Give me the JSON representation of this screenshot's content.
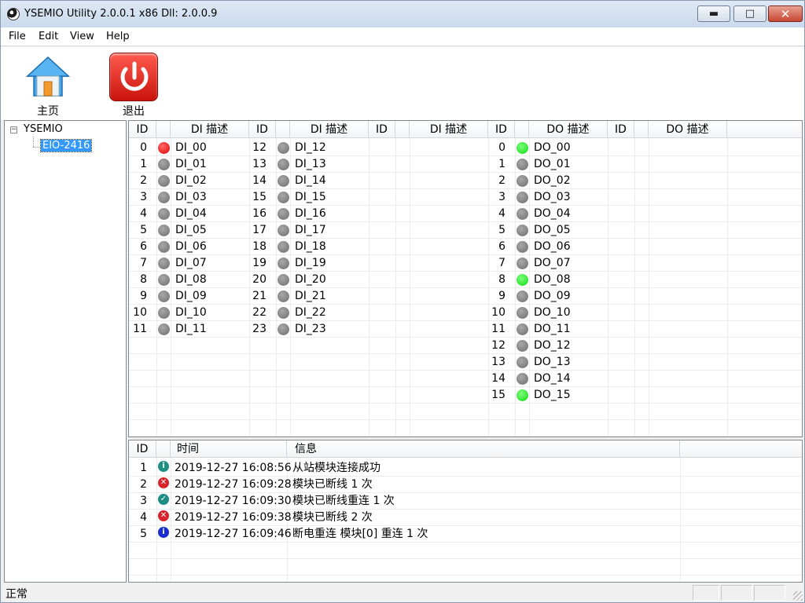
{
  "window": {
    "title": "YSEMIO Utility 2.0.0.1 x86 Dll: 2.0.0.9"
  },
  "menu": [
    "File",
    "Edit",
    "View",
    "Help"
  ],
  "toolbar": {
    "home_label": "主页",
    "exit_label": "退出"
  },
  "tree": {
    "root": "YSEMIO",
    "child": "EIO-2416",
    "expander": "−"
  },
  "io_headers": {
    "id": "ID",
    "di_desc": "DI 描述",
    "do_desc": "DO 描述"
  },
  "di_col1": [
    {
      "id": "0",
      "name": "DI_00",
      "state": "red"
    },
    {
      "id": "1",
      "name": "DI_01",
      "state": "gray"
    },
    {
      "id": "2",
      "name": "DI_02",
      "state": "gray"
    },
    {
      "id": "3",
      "name": "DI_03",
      "state": "gray"
    },
    {
      "id": "4",
      "name": "DI_04",
      "state": "gray"
    },
    {
      "id": "5",
      "name": "DI_05",
      "state": "gray"
    },
    {
      "id": "6",
      "name": "DI_06",
      "state": "gray"
    },
    {
      "id": "7",
      "name": "DI_07",
      "state": "gray"
    },
    {
      "id": "8",
      "name": "DI_08",
      "state": "gray"
    },
    {
      "id": "9",
      "name": "DI_09",
      "state": "gray"
    },
    {
      "id": "10",
      "name": "DI_10",
      "state": "gray"
    },
    {
      "id": "11",
      "name": "DI_11",
      "state": "gray"
    }
  ],
  "di_col2": [
    {
      "id": "12",
      "name": "DI_12",
      "state": "gray"
    },
    {
      "id": "13",
      "name": "DI_13",
      "state": "gray"
    },
    {
      "id": "14",
      "name": "DI_14",
      "state": "gray"
    },
    {
      "id": "15",
      "name": "DI_15",
      "state": "gray"
    },
    {
      "id": "16",
      "name": "DI_16",
      "state": "gray"
    },
    {
      "id": "17",
      "name": "DI_17",
      "state": "gray"
    },
    {
      "id": "18",
      "name": "DI_18",
      "state": "gray"
    },
    {
      "id": "19",
      "name": "DI_19",
      "state": "gray"
    },
    {
      "id": "20",
      "name": "DI_20",
      "state": "gray"
    },
    {
      "id": "21",
      "name": "DI_21",
      "state": "gray"
    },
    {
      "id": "22",
      "name": "DI_22",
      "state": "gray"
    },
    {
      "id": "23",
      "name": "DI_23",
      "state": "gray"
    }
  ],
  "do_col1": [
    {
      "id": "0",
      "name": "DO_00",
      "state": "green"
    },
    {
      "id": "1",
      "name": "DO_01",
      "state": "gray"
    },
    {
      "id": "2",
      "name": "DO_02",
      "state": "gray"
    },
    {
      "id": "3",
      "name": "DO_03",
      "state": "gray"
    },
    {
      "id": "4",
      "name": "DO_04",
      "state": "gray"
    },
    {
      "id": "5",
      "name": "DO_05",
      "state": "gray"
    },
    {
      "id": "6",
      "name": "DO_06",
      "state": "gray"
    },
    {
      "id": "7",
      "name": "DO_07",
      "state": "gray"
    },
    {
      "id": "8",
      "name": "DO_08",
      "state": "green"
    },
    {
      "id": "9",
      "name": "DO_09",
      "state": "gray"
    },
    {
      "id": "10",
      "name": "DO_10",
      "state": "gray"
    },
    {
      "id": "11",
      "name": "DO_11",
      "state": "gray"
    },
    {
      "id": "12",
      "name": "DO_12",
      "state": "gray"
    },
    {
      "id": "13",
      "name": "DO_13",
      "state": "gray"
    },
    {
      "id": "14",
      "name": "DO_14",
      "state": "gray"
    },
    {
      "id": "15",
      "name": "DO_15",
      "state": "green"
    }
  ],
  "state_colors": {
    "red": "#e00000",
    "green": "#11d911",
    "gray": "#7a7a7a"
  },
  "log": {
    "headers": {
      "id": "ID",
      "time": "时间",
      "info": "信息"
    },
    "rows": [
      {
        "id": "1",
        "icon": "info-teal",
        "time": "2019-12-27 16:08:56",
        "info": "从站模块连接成功"
      },
      {
        "id": "2",
        "icon": "error",
        "time": "2019-12-27 16:09:28",
        "info": "模块已断线 1 次"
      },
      {
        "id": "3",
        "icon": "ok",
        "time": "2019-12-27 16:09:30",
        "info": "模块已断线重连 1 次"
      },
      {
        "id": "4",
        "icon": "error",
        "time": "2019-12-27 16:09:38",
        "info": "模块已断线 2 次"
      },
      {
        "id": "5",
        "icon": "info-blue",
        "time": "2019-12-27 16:09:46",
        "info": "断电重连 模块[0] 重连 1 次"
      }
    ]
  },
  "status": {
    "text": "正常"
  }
}
